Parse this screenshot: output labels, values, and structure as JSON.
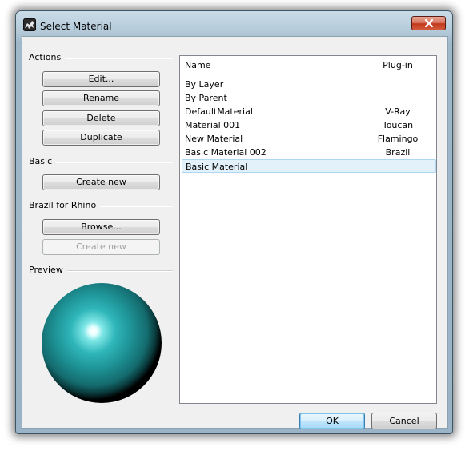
{
  "window": {
    "title": "Select Material"
  },
  "groups": {
    "actions": {
      "label": "Actions",
      "buttons": {
        "edit": "Edit...",
        "rename": "Rename",
        "delete": "Delete",
        "duplicate": "Duplicate"
      }
    },
    "basic": {
      "label": "Basic",
      "create_new": "Create new"
    },
    "brazil": {
      "label": "Brazil for Rhino",
      "browse": "Browse...",
      "create_new": "Create new",
      "create_new_enabled": false
    },
    "preview": {
      "label": "Preview",
      "sphere_color": "#1e9396"
    }
  },
  "list": {
    "columns": {
      "name": "Name",
      "plugin": "Plug-in"
    },
    "rows": [
      {
        "name": "By Layer",
        "plugin": ""
      },
      {
        "name": "By Parent",
        "plugin": ""
      },
      {
        "name": "DefaultMaterial",
        "plugin": "V-Ray"
      },
      {
        "name": "Material 001",
        "plugin": "Toucan"
      },
      {
        "name": "New Material",
        "plugin": "Flamingo"
      },
      {
        "name": "Basic Material 002",
        "plugin": "Brazil"
      },
      {
        "name": "Basic Material",
        "plugin": ""
      }
    ],
    "selected_row": "Basic Material"
  },
  "dialog_buttons": {
    "ok": "OK",
    "cancel": "Cancel"
  },
  "colors": {
    "selection_bg": "#e3f1fb",
    "selection_border": "#aed6f2",
    "close_button": "#c0391d"
  }
}
